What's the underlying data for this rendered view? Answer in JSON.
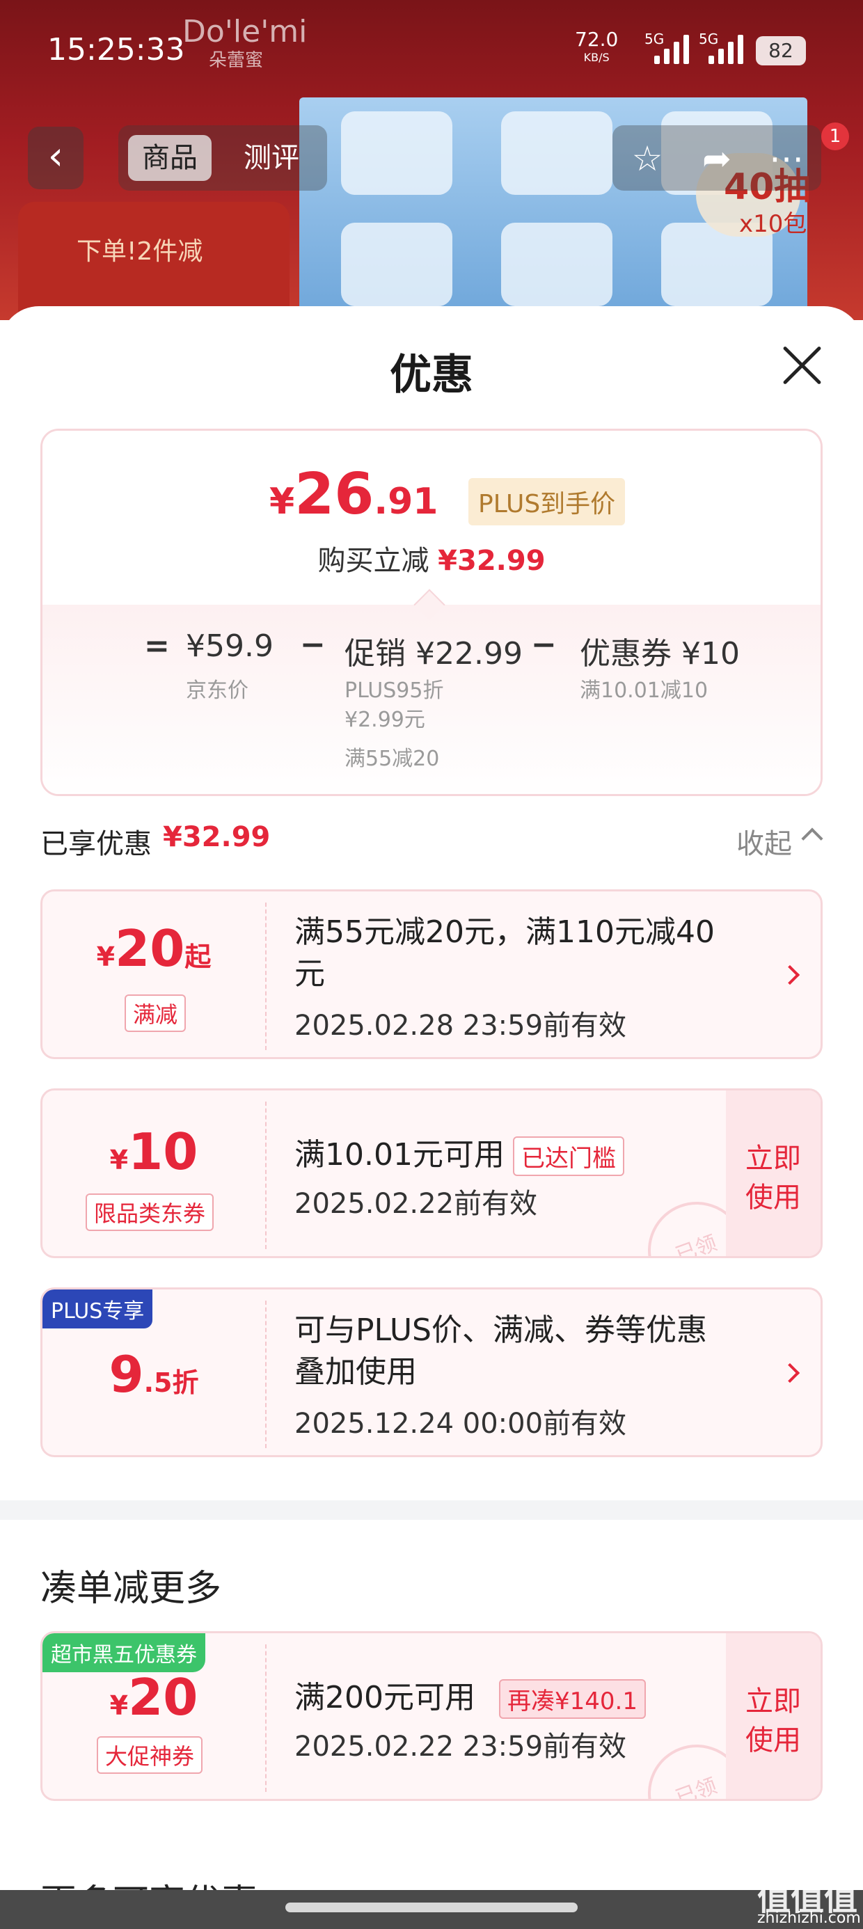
{
  "status_bar": {
    "time": "15:25:33",
    "net_speed": "72.0",
    "net_unit": "KB/S",
    "signal_1": "5G",
    "signal_2": "5G",
    "battery": "82"
  },
  "background": {
    "brand_text": "Do'le'mi",
    "brand_sub": "朵蕾蜜",
    "promo_text": "下单!2件减",
    "pack_badge_main": "40抽",
    "pack_badge_sub": "x10包"
  },
  "nav": {
    "back_icon": "chevron-left-icon",
    "tabs": [
      "商品",
      "测评"
    ],
    "active_tab": "商品",
    "notification_count": "1"
  },
  "sheet": {
    "title": "优惠",
    "price_card": {
      "currency": "¥",
      "price_int": "26",
      "price_dec": ".91",
      "plus_tag": "PLUS到手价",
      "buy_label": "购买立减",
      "buy_amount": "¥32.99",
      "equals": "=",
      "minus": "−",
      "jd_price": "¥59.9",
      "jd_label": "京东价",
      "promo_value": "促销 ¥22.99",
      "promo_sub_1": "PLUS95折",
      "promo_sub_2": "¥2.99元",
      "promo_sub_3": "满55减20",
      "coupon_value": "优惠券 ¥10",
      "coupon_sub": "满10.01减10"
    },
    "enjoyed": {
      "label": "已享优惠",
      "amount": "¥32.99",
      "collapse": "收起"
    },
    "coupons": [
      {
        "currency": "¥",
        "amount": "20",
        "suffix": "起",
        "label": "满减",
        "text_1": "满55元减20元，满110元减40",
        "text_2": "元",
        "date": "2025.02.28 23:59前有效"
      },
      {
        "currency": "¥",
        "amount": "10",
        "label": "限品类东券",
        "text_1": "满10.01元可用",
        "tag": "已达门槛",
        "date": "2025.02.22前有效",
        "action_1": "立即",
        "action_2": "使用",
        "stamp": "已领"
      },
      {
        "corner": "PLUS专享",
        "amount": "9",
        "suffix": ".5折",
        "text_1": "可与PLUS价、满减、券等优惠",
        "text_2": "叠加使用",
        "date": "2025.12.24 00:00前有效"
      }
    ],
    "section_more": "凑单减更多",
    "extra_coupon": {
      "corner": "超市黑五优惠券",
      "currency": "¥",
      "amount": "20",
      "label": "大促神券",
      "text_1": "满200元可用",
      "tag": "再凑¥140.1",
      "date": "2025.02.22 23:59前有效",
      "action_1": "立即",
      "action_2": "使用",
      "stamp": "已领"
    },
    "more_title": "更多可享优惠"
  },
  "watermark": {
    "main": "值值值",
    "sub": "zhizhizhi.com"
  },
  "colors": {
    "accent_red": "#e5263a",
    "plus_gold": "#b07a2e",
    "plus_blue": "#2c47b7",
    "green_tag": "#3cc46a"
  }
}
